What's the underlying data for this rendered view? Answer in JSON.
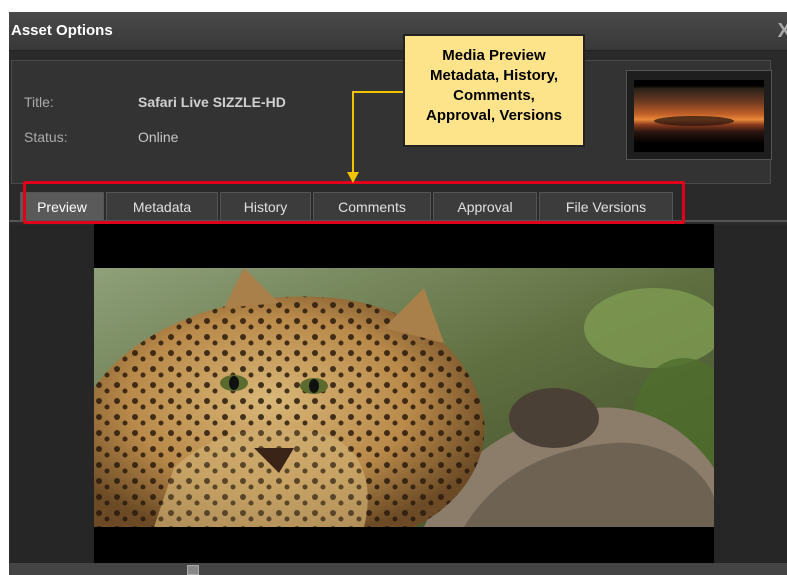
{
  "window": {
    "title": "Asset Options",
    "close_glyph": "X"
  },
  "asset": {
    "title_label": "Title:",
    "title_value": "Safari Live SIZZLE-HD",
    "status_label": "Status:",
    "status_value": "Online"
  },
  "tabs": [
    {
      "label": "Preview",
      "active": true
    },
    {
      "label": "Metadata",
      "active": false
    },
    {
      "label": "History",
      "active": false
    },
    {
      "label": "Comments",
      "active": false
    },
    {
      "label": "Approval",
      "active": false
    },
    {
      "label": "File Versions",
      "active": false
    }
  ],
  "callout": {
    "lines": [
      "Media Preview",
      "Metadata, History,",
      "Comments,",
      "Approval, Versions"
    ]
  },
  "colors": {
    "highlight": "#e0001a",
    "callout_bg": "#fde38a",
    "arrow": "#f3c300"
  },
  "icons": {
    "close": "close-icon"
  }
}
